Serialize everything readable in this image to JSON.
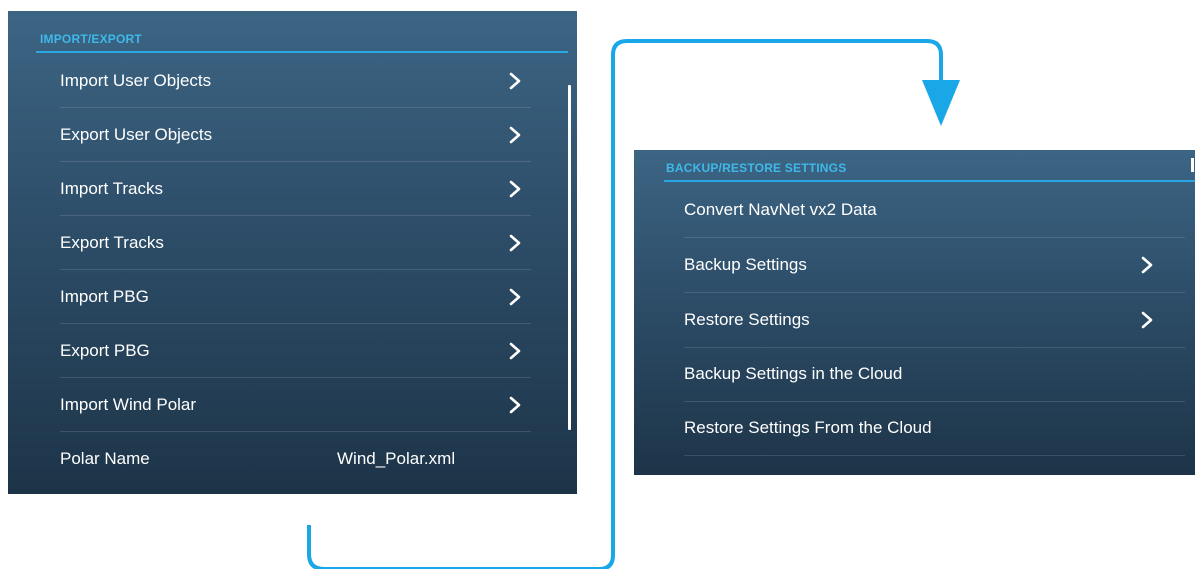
{
  "import_export": {
    "header": "IMPORT/EXPORT",
    "items": [
      {
        "label": "Import User Objects",
        "has_chevron": true
      },
      {
        "label": "Export User Objects",
        "has_chevron": true
      },
      {
        "label": "Import Tracks",
        "has_chevron": true
      },
      {
        "label": "Export Tracks",
        "has_chevron": true
      },
      {
        "label": "Import PBG",
        "has_chevron": true
      },
      {
        "label": "Export PBG",
        "has_chevron": true
      },
      {
        "label": "Import Wind Polar",
        "has_chevron": true
      },
      {
        "label": "Polar Name",
        "value": "Wind_Polar.xml",
        "has_chevron": false
      }
    ]
  },
  "backup_restore": {
    "header": "BACKUP/RESTORE SETTINGS",
    "items": [
      {
        "label": "Convert NavNet vx2 Data",
        "has_chevron": false
      },
      {
        "label": "Backup Settings",
        "has_chevron": true
      },
      {
        "label": "Restore Settings",
        "has_chevron": true
      },
      {
        "label": "Backup Settings in the Cloud",
        "has_chevron": false
      },
      {
        "label": "Restore Settings From the Cloud",
        "has_chevron": false
      }
    ]
  },
  "connector": {
    "color": "#1aa7e8",
    "icon": "flow-arrow-icon"
  },
  "colors": {
    "header_accent": "#3fb8ea",
    "panel_top": "#3c6584",
    "panel_bottom": "#1d3448",
    "text": "#ffffff"
  }
}
